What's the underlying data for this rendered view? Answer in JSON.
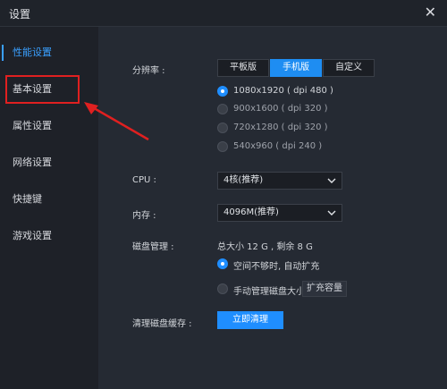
{
  "window": {
    "title": "设置"
  },
  "sidebar": {
    "items": [
      {
        "label": "性能设置",
        "active": true
      },
      {
        "label": "基本设置",
        "active": false
      },
      {
        "label": "属性设置",
        "active": false
      },
      {
        "label": "网络设置",
        "active": false
      },
      {
        "label": "快捷键",
        "active": false
      },
      {
        "label": "游戏设置",
        "active": false
      }
    ]
  },
  "performance": {
    "resolution_label": "分辨率 :",
    "resolution_tabs": [
      "平板版",
      "手机版",
      "自定义"
    ],
    "resolution_selected": "手机版",
    "resolutions": [
      {
        "text": "1080x1920 ( dpi 480 )",
        "checked": true
      },
      {
        "text": "900x1600 ( dpi 320 )",
        "checked": false
      },
      {
        "text": "720x1280 ( dpi 320 )",
        "checked": false
      },
      {
        "text": "540x960 ( dpi 240 )",
        "checked": false
      }
    ],
    "cpu_label": "CPU :",
    "cpu_value": "4核(推荐)",
    "memory_label": "内存 :",
    "memory_value": "4096M(推荐)",
    "disk_label": "磁盘管理 :",
    "disk_summary": "总大小 12 G , 剩余 8 G",
    "disk_options": [
      {
        "text": "空间不够时, 自动扩充",
        "checked": true
      },
      {
        "text": "手动管理磁盘大小",
        "checked": false
      }
    ],
    "expand_button": "扩充容量",
    "cache_label": "清理磁盘缓存 :",
    "cache_button": "立即清理"
  },
  "colors": {
    "accent": "#1f8eff",
    "highlight": "#e02020"
  },
  "icons": {
    "close": "close-icon",
    "dropdown": "chevron-down-icon",
    "arrow": "red-arrow-icon"
  }
}
